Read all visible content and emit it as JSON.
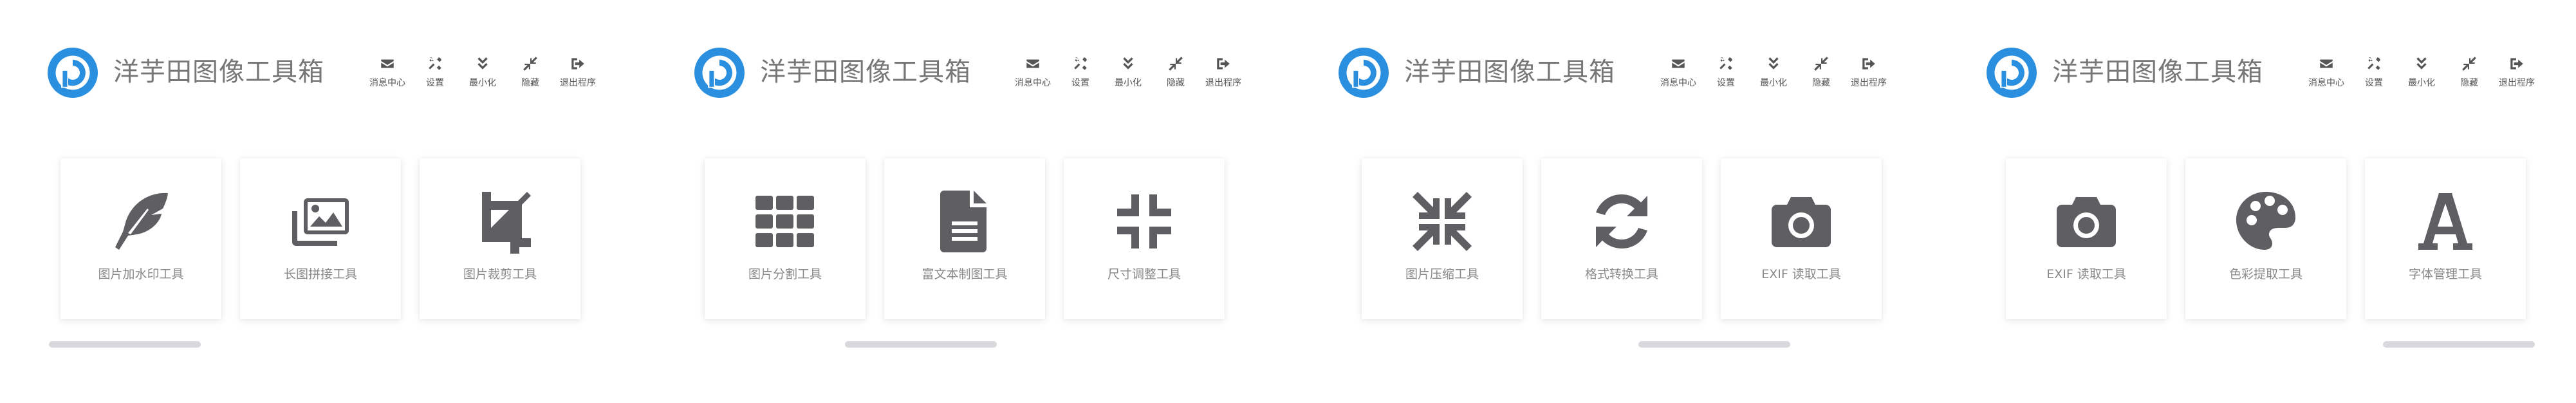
{
  "colors": {
    "logo_blue": "#2b8fe0",
    "icon_gray": "#555555",
    "title_gray": "#777777",
    "label_gray": "#8a8a8a",
    "scrollbar": "#d8d9dd"
  },
  "toolbar": [
    {
      "label": "消息中心",
      "icon": "envelope-icon"
    },
    {
      "label": "设置",
      "icon": "tools-icon"
    },
    {
      "label": "最小化",
      "icon": "double-chevron-down-icon"
    },
    {
      "label": "隐藏",
      "icon": "compress-arrows-icon"
    },
    {
      "label": "退出程序",
      "icon": "sign-out-icon"
    }
  ],
  "panels": [
    {
      "title": "洋芋田图像工具箱",
      "cards": [
        {
          "label": "图片加水印工具",
          "icon": "feather-icon"
        },
        {
          "label": "长图拼接工具",
          "icon": "images-icon"
        },
        {
          "label": "图片裁剪工具",
          "icon": "crop-icon"
        }
      ]
    },
    {
      "title": "洋芋田图像工具箱",
      "cards": [
        {
          "label": "图片分割工具",
          "icon": "grid-icon"
        },
        {
          "label": "富文本制图工具",
          "icon": "file-text-icon"
        },
        {
          "label": "尺寸调整工具",
          "icon": "compress-icon"
        }
      ]
    },
    {
      "title": "洋芋田图像工具箱",
      "cards": [
        {
          "label": "图片压缩工具",
          "icon": "compress-arrows-alt-icon"
        },
        {
          "label": "格式转换工具",
          "icon": "sync-icon"
        },
        {
          "label": "EXIF 读取工具",
          "icon": "camera-icon"
        }
      ]
    },
    {
      "title": "洋芋田图像工具箱",
      "cards": [
        {
          "label": "EXIF 读取工具",
          "icon": "camera-icon"
        },
        {
          "label": "色彩提取工具",
          "icon": "palette-icon"
        },
        {
          "label": "字体管理工具",
          "icon": "font-icon"
        }
      ]
    }
  ]
}
